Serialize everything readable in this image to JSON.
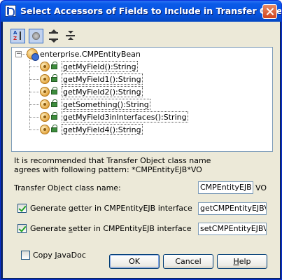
{
  "window": {
    "title": "Select Accessors of Fields to Include in Transfer Object"
  },
  "toolbar": {
    "sort_icon": "sort-alpha-icon",
    "show_inherited_icon": "circle-icon",
    "expand_all_icon": "expand-all-icon",
    "collapse_all_icon": "collapse-all-icon"
  },
  "tree": {
    "root": {
      "expander": "−",
      "label": "enterprise.CMPEntityBean"
    },
    "items": [
      {
        "label": "getMyField():String"
      },
      {
        "label": "getMyField1():String"
      },
      {
        "label": "getMyField2():String"
      },
      {
        "label": "getSomething():String"
      },
      {
        "label": "getMyField3inInterfaces():String"
      },
      {
        "label": "getMyField4():String"
      }
    ]
  },
  "info": {
    "line1": "It is recommended that Transfer Object class name",
    "line2": "agrees with following pattern: *CMPEntityEJB*VO"
  },
  "form": {
    "class_name_label": "Transfer Object class name:",
    "class_name_value": "CMPEntityEJB",
    "class_name_suffix": "VO",
    "getter_prefix": "Generate ",
    "getter_mnemonic": "g",
    "getter_rest": "etter in CMPEntityEJB interface",
    "getter_checked": true,
    "getter_value": "getCMPEntityEJBVO",
    "setter_prefix": "Generate ",
    "setter_mnemonic": "s",
    "setter_rest": "etter in CMPEntityEJB interface",
    "setter_checked": true,
    "setter_value": "setCMPEntityEJBVO",
    "copy_javadoc_prefix": "Copy ",
    "copy_javadoc_mnemonic": "J",
    "copy_javadoc_rest": "avaDoc",
    "copy_javadoc_checked": false
  },
  "buttons": {
    "ok": "OK",
    "cancel": "Cancel",
    "help_mnemonic": "H",
    "help_rest": "elp"
  }
}
